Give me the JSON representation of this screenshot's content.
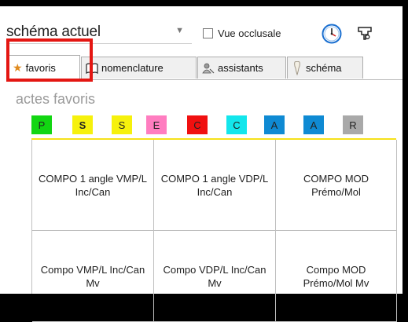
{
  "toolbar": {
    "schema_select_value": "schéma actuel",
    "vue_occlusale_label": "Vue occlusale"
  },
  "tabs": [
    {
      "label": "favoris",
      "icon": "star-icon"
    },
    {
      "label": "nomenclature",
      "icon": "book-icon"
    },
    {
      "label": "assistants",
      "icon": "wizard-icon"
    },
    {
      "label": "schéma",
      "icon": "tooth-icon"
    }
  ],
  "section": {
    "title": "actes favoris"
  },
  "categories": [
    {
      "label": "P",
      "color": "#12d612",
      "bold": false
    },
    {
      "label": "S",
      "color": "#f6f10c",
      "bold": true
    },
    {
      "label": "S",
      "color": "#f6f10c",
      "bold": false
    },
    {
      "label": "E",
      "color": "#ff7dc0",
      "bold": false
    },
    {
      "label": "C",
      "color": "#f01010",
      "bold": false
    },
    {
      "label": "C",
      "color": "#13e6ec",
      "bold": false
    },
    {
      "label": "A",
      "color": "#0f8ad3",
      "bold": false
    },
    {
      "label": "A",
      "color": "#0f8ad3",
      "bold": false
    },
    {
      "label": "R",
      "color": "#a9a9a9",
      "bold": false
    }
  ],
  "favorites": [
    [
      "COMPO 1 angle VMP/L Inc/Can",
      "COMPO 1 angle VDP/L Inc/Can",
      "COMPO MOD Prémo/Mol"
    ],
    [
      "Compo VMP/L Inc/Can Mv",
      "Compo VDP/L Inc/Can Mv",
      "Compo MOD Prémo/Mol Mv"
    ]
  ],
  "colors": {
    "active_tab_highlight": "#e41612",
    "star": "#e08a1e",
    "grid_top": "#f6e11a"
  }
}
